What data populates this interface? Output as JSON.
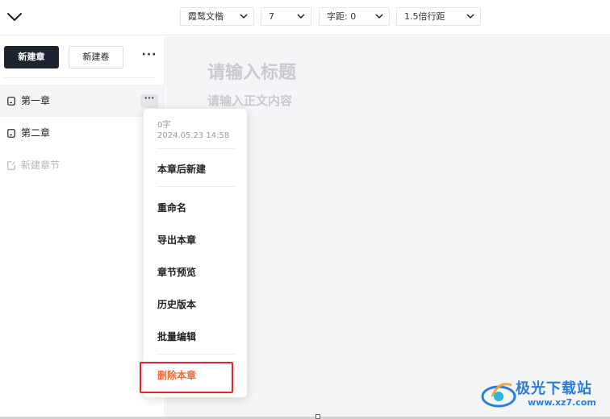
{
  "toolbar": {
    "font": "霞鹜文楷",
    "font_size": "7",
    "letter_spacing": "字距: 0",
    "line_spacing": "1.5倍行距"
  },
  "sidebar": {
    "new_chapter_label": "新建章",
    "new_volume_label": "新建卷",
    "more_label": "···",
    "chapters": [
      {
        "label": "第一章"
      },
      {
        "label": "第二章"
      }
    ],
    "new_section_label": "新建章节",
    "row_more_label": "···"
  },
  "editor": {
    "title_placeholder": "请输入标题",
    "body_placeholder": "请输入正文内容"
  },
  "context_menu": {
    "word_count": "0字",
    "timestamp": "2024.05.23 14:58",
    "items": [
      {
        "label": "本章后新建"
      },
      {
        "label": "重命名"
      },
      {
        "label": "导出本章"
      },
      {
        "label": "章节预览"
      },
      {
        "label": "历史版本"
      },
      {
        "label": "批量编辑"
      },
      {
        "label": "删除本章"
      }
    ]
  },
  "watermark": {
    "brand": "极光下载站",
    "url": "www.xz7.com"
  },
  "colors": {
    "primary_button": "#1d2430",
    "danger": "#ef6a38",
    "highlight_box": "#e3252c",
    "editor_bg": "#f4f5f7",
    "watermark": "#2b7de0"
  }
}
